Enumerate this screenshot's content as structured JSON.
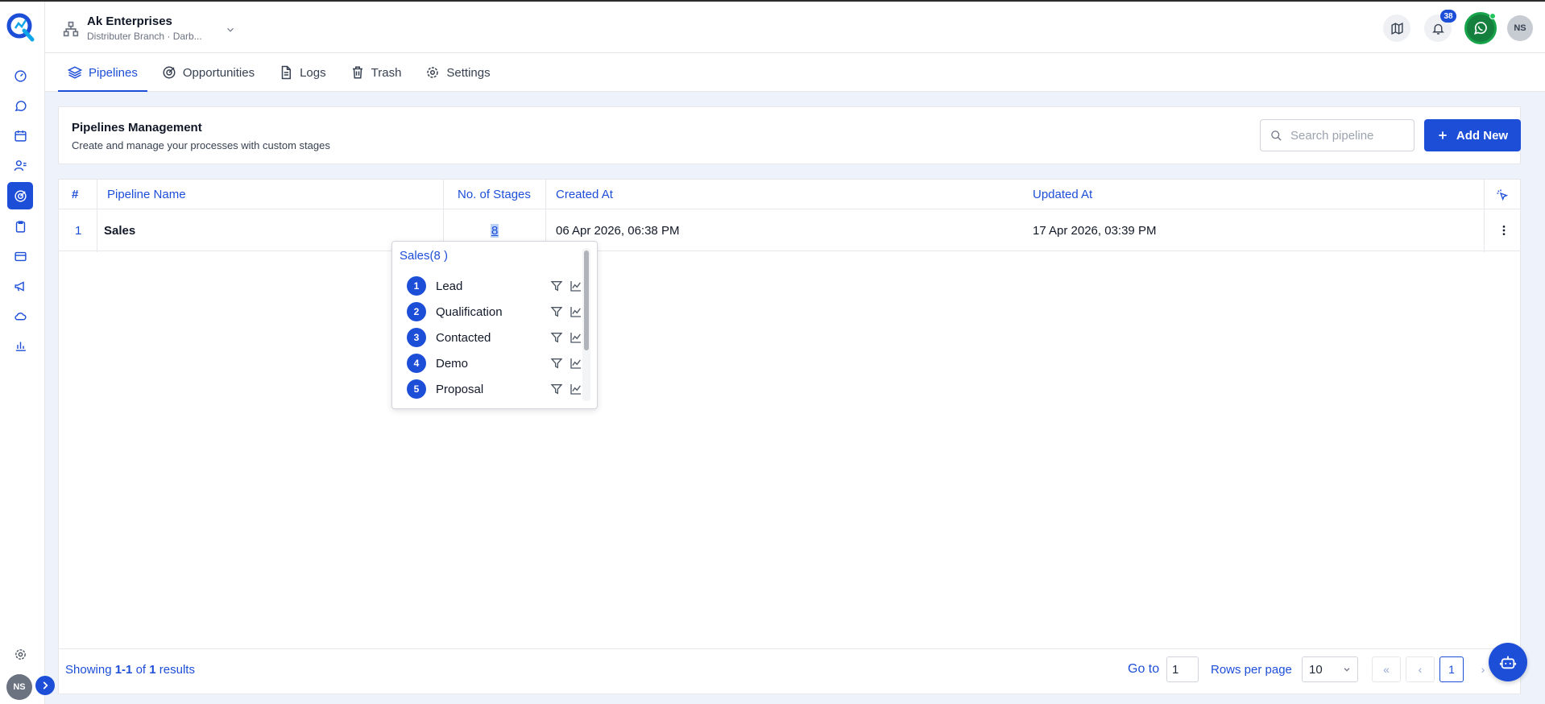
{
  "header": {
    "org_name": "Ak Enterprises",
    "org_sub": "Distributer Branch · Darb...",
    "notification_count": "38",
    "user_initials": "NS"
  },
  "sidebar": {
    "icons": [
      "dashboard-icon",
      "chat-icon",
      "calendar-icon",
      "contacts-icon",
      "pipeline-icon",
      "clipboard-icon",
      "card-icon",
      "megaphone-icon",
      "cloud-icon",
      "chart-icon"
    ],
    "user_initials": "NS"
  },
  "tabs": [
    {
      "label": "Pipelines",
      "active": true
    },
    {
      "label": "Opportunities"
    },
    {
      "label": "Logs"
    },
    {
      "label": "Trash"
    },
    {
      "label": "Settings"
    }
  ],
  "page": {
    "title": "Pipelines Management",
    "subtitle": "Create and manage your processes with custom stages",
    "search_placeholder": "Search pipeline",
    "add_label": "Add New"
  },
  "table": {
    "columns": [
      "#",
      "Pipeline Name",
      "No. of Stages",
      "Created At",
      "Updated At"
    ],
    "rows": [
      {
        "index": "1",
        "name": "Sales",
        "stages": "8",
        "created": "06 Apr 2026, 06:38 PM",
        "updated": "17 Apr 2026, 03:39 PM"
      }
    ]
  },
  "popover": {
    "title": "Sales(8 )",
    "stages": [
      {
        "num": "1",
        "name": "Lead"
      },
      {
        "num": "2",
        "name": "Qualification"
      },
      {
        "num": "3",
        "name": "Contacted"
      },
      {
        "num": "4",
        "name": "Demo"
      },
      {
        "num": "5",
        "name": "Proposal"
      }
    ]
  },
  "footer": {
    "showing_prefix": "Showing",
    "showing_range": "1-1",
    "showing_of": "of",
    "showing_total": "1",
    "showing_suffix": "results",
    "goto_label": "Go to",
    "goto_value": "1",
    "rows_label": "Rows per page",
    "rows_value": "10",
    "current_page": "1",
    "first_label": "«",
    "prev_label": "‹",
    "next_label": "›"
  },
  "colors": {
    "accent": "#1d4ed8",
    "whatsapp": "#15803d"
  }
}
